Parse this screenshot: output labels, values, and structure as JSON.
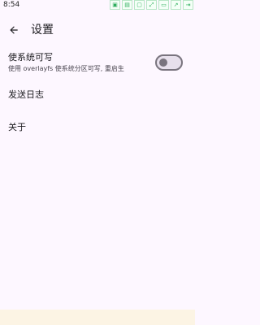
{
  "status_bar": {
    "time": "8:54",
    "icons": [
      "qr-icon",
      "document-icon",
      "copy-icon",
      "expand-icon",
      "image-icon",
      "share-icon",
      "export-icon"
    ]
  },
  "header": {
    "title": "设置"
  },
  "settings": {
    "writable": {
      "title": "使系统可写",
      "subtitle": "使用 overlayfs 使系统分区可写, 重启生",
      "enabled": false
    },
    "send_log": {
      "label": "发送日志"
    },
    "about": {
      "label": "关于"
    }
  },
  "colors": {
    "background": "#fdf7ff",
    "switch_off": "#79747e",
    "bottom_bar": "#fcf4e4"
  }
}
